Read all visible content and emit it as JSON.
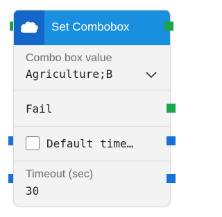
{
  "node": {
    "title": "Set Combobox",
    "icon": "salesforce-cloud-icon",
    "colors": {
      "header": "#1a8fe0",
      "icon_tile": "#1466c9",
      "flow_port": "#1aa64a",
      "input_port": "#1673d6"
    }
  },
  "combo": {
    "label": "Combo box value",
    "value": "Agriculture;B",
    "dropdown_icon": "chevron-down-icon"
  },
  "fail": {
    "label": "Fail"
  },
  "default_timeout": {
    "label": "Default time…",
    "checked": false
  },
  "timeout": {
    "label": "Timeout (sec)",
    "value": "30"
  }
}
